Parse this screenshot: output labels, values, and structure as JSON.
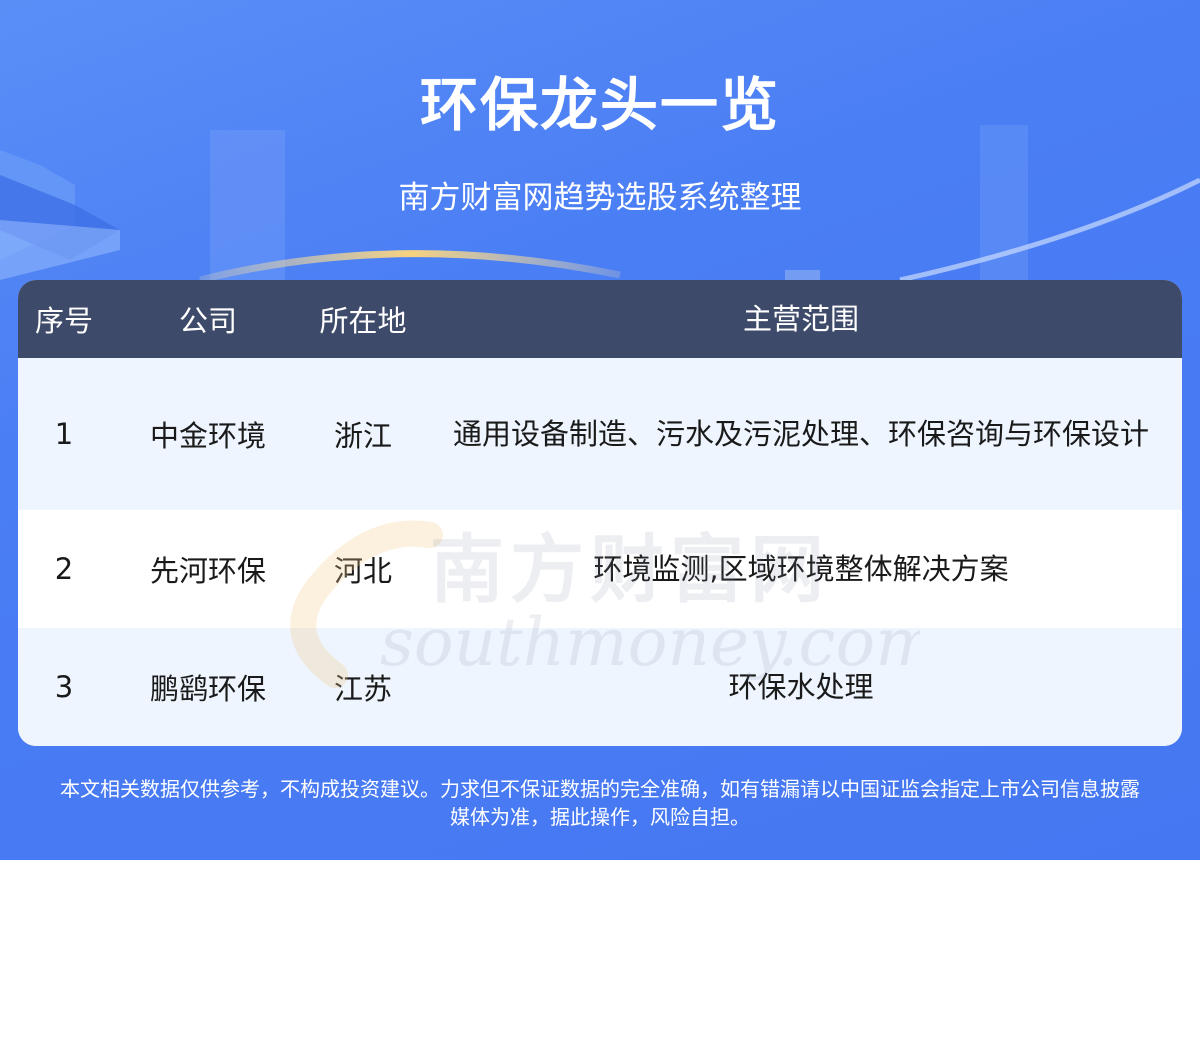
{
  "header": {
    "title": "环保龙头一览",
    "subtitle": "南方财富网趋势选股系统整理"
  },
  "table": {
    "columns": [
      "序号",
      "公司",
      "所在地",
      "主营范围"
    ],
    "rows": [
      {
        "index": "1",
        "company": "中金环境",
        "location": "浙江",
        "business": "通用设备制造、污水及污泥处理、环保咨询与环保设计"
      },
      {
        "index": "2",
        "company": "先河环保",
        "location": "河北",
        "business": "环境监测,区域环境整体解决方案"
      },
      {
        "index": "3",
        "company": "鹏鹞环保",
        "location": "江苏",
        "business": "环保水处理"
      }
    ]
  },
  "watermark": {
    "cn": "南方财富网",
    "en": "southmoney.com"
  },
  "disclaimer": {
    "line1": "本文相关数据仅供参考，不构成投资建议。力求但不保证数据的完全准确，如有错漏请以中国证监会指定上市公司信息披露",
    "line2": "媒体为准，据此操作，风险自担。"
  },
  "colors": {
    "background": "#4a7ef4",
    "table_header": "#3e4a6a",
    "row_light": "#eef5fe",
    "row_white": "#ffffff"
  }
}
